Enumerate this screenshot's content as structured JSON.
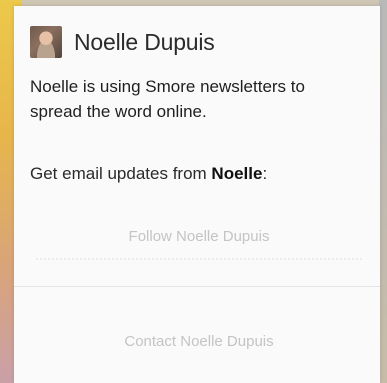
{
  "profile": {
    "name": "Noelle Dupuis",
    "bio": "Noelle is using Smore newsletters to spread the word online."
  },
  "updates": {
    "prefix": "Get email updates from ",
    "name": "Noelle",
    "suffix": ":"
  },
  "actions": {
    "follow_label": "Follow Noelle Dupuis",
    "contact_label": "Contact Noelle Dupuis"
  },
  "colors": {
    "button_text": "#c4c4c4",
    "text": "#1f1f1f"
  },
  "icons": {
    "avatar": "profile-photo"
  }
}
